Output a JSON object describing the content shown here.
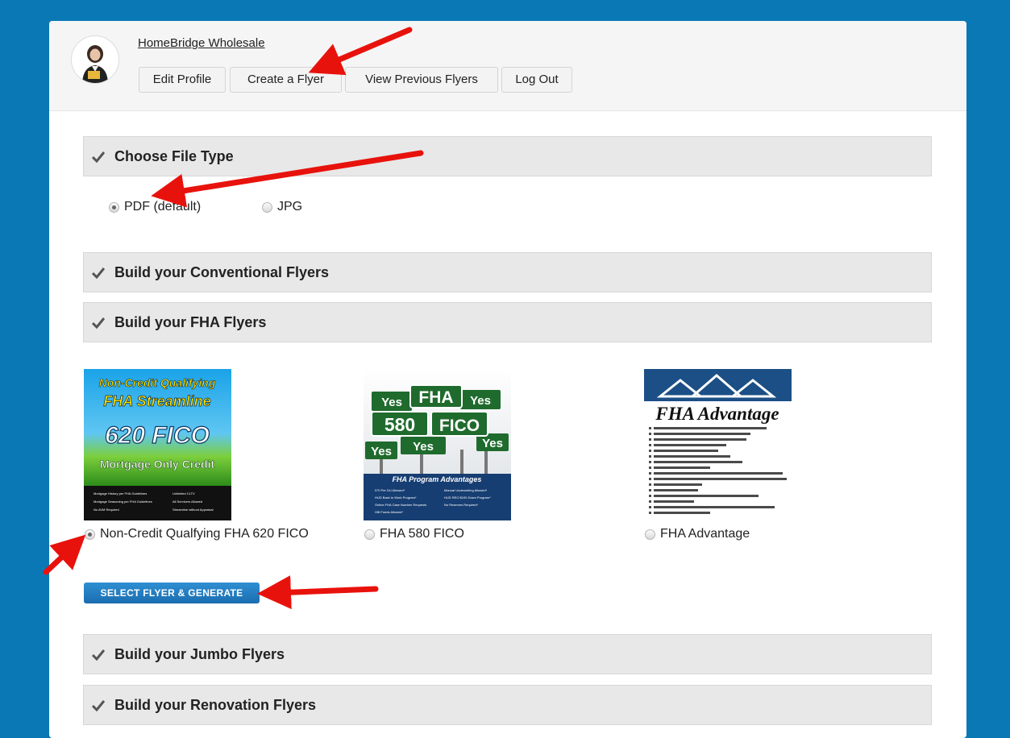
{
  "header": {
    "company": "HomeBridge Wholesale",
    "buttons": [
      "Edit Profile",
      "Create a Flyer",
      "View Previous Flyers",
      "Log Out"
    ]
  },
  "sections": {
    "file_type": "Choose File Type",
    "conventional": "Build your Conventional Flyers",
    "fha": "Build your FHA Flyers",
    "jumbo": "Build your Jumbo Flyers",
    "renovation": "Build your Renovation Flyers"
  },
  "file_type": {
    "options": [
      "PDF (default)",
      "JPG"
    ],
    "selected": "PDF (default)"
  },
  "flyers": {
    "selected": "Non-Credit Qualfying FHA 620 FICO",
    "items": [
      {
        "label": "Non-Credit Qualfying FHA 620 FICO",
        "art": {
          "line1": "Non-Credit Qualifying",
          "line2": "FHA Streamline",
          "line3": "620 FICO",
          "line4": "Mortgage Only Credit",
          "bullets": [
            "Mortgage History per FHA Guidelines",
            "Unlimited CLTV",
            "Mortgage Seasoning per FHA Guidelines",
            "All Servicers Allowed",
            "No AVM Required",
            "Streamline without Appraisal"
          ]
        }
      },
      {
        "label": "FHA 580 FICO",
        "art": {
          "sign1": "FHA",
          "sign2": "580",
          "sign3": "FICO",
          "yes": "Yes",
          "banner": "FHA Program Advantages",
          "bullets": [
            "DTI Per DU Allowed*",
            "Manual Underwriting Allowed*",
            "HUD Back to Work Program*",
            "HUD REO $100 Down Program*",
            "Online FHA Case Number Requests",
            "No Reserves Required*",
            "Gift Funds Allowed*"
          ]
        }
      },
      {
        "label": "FHA Advantage",
        "art": {
          "title": "FHA Advantage"
        }
      }
    ]
  },
  "generate_button": "SELECT FLYER & GENERATE",
  "colors": {
    "page_bg": "#0a78b4",
    "header_bg": "#f5f5f5",
    "section_bg": "#e8e8e8",
    "button_blue": "#1f7cc1",
    "arrow_red": "#e8120c"
  }
}
